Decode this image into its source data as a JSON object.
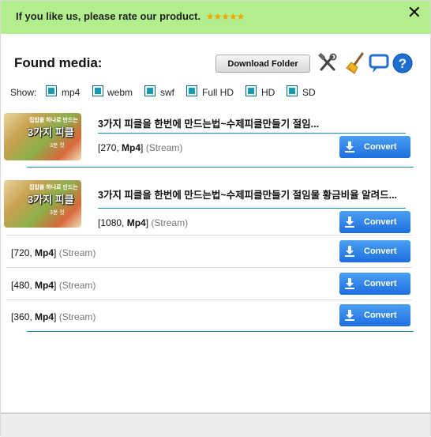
{
  "banner": {
    "text": "If you like us, please rate our product.",
    "stars": "★★★★★"
  },
  "close_glyph": "✕",
  "header": {
    "title": "Found media:",
    "download_folder_label": "Download Folder"
  },
  "filters": {
    "show_label": "Show:",
    "options": [
      "mp4",
      "webm",
      "swf",
      "Full HD",
      "HD",
      "SD"
    ]
  },
  "media": [
    {
      "title": "3가지 피클을 한번에 만드는법~수제피클만들기 절임...",
      "thumb_lines": [
        "집밥을 하나로 만드는",
        "3가지 피클",
        "3분 컷"
      ],
      "streams": [
        {
          "res": "270",
          "fmt": "Mp4",
          "kind": "(Stream)",
          "action": "Convert"
        }
      ]
    },
    {
      "title": "3가지 피클을 한번에 만드는법~수제피클만들기 절임물 황금비율 알려드...",
      "thumb_lines": [
        "집밥을 하나로 만드는",
        "3가지 피클",
        "3분 컷"
      ],
      "streams": [
        {
          "res": "1080",
          "fmt": "Mp4",
          "kind": "(Stream)",
          "action": "Convert"
        },
        {
          "res": "720",
          "fmt": "Mp4",
          "kind": "(Stream)",
          "action": "Convert"
        },
        {
          "res": "480",
          "fmt": "Mp4",
          "kind": "(Stream)",
          "action": "Convert"
        },
        {
          "res": "360",
          "fmt": "Mp4",
          "kind": "(Stream)",
          "action": "Convert"
        }
      ]
    }
  ],
  "icons": [
    "settings-tools-icon",
    "broom-clean-icon",
    "chat-feedback-icon",
    "help-icon"
  ],
  "colors": {
    "banner_bg": "#b3ee8e",
    "convert_bg": "#2f86ea",
    "checkbox": "#1699b5",
    "divider": "#1b8db3"
  }
}
